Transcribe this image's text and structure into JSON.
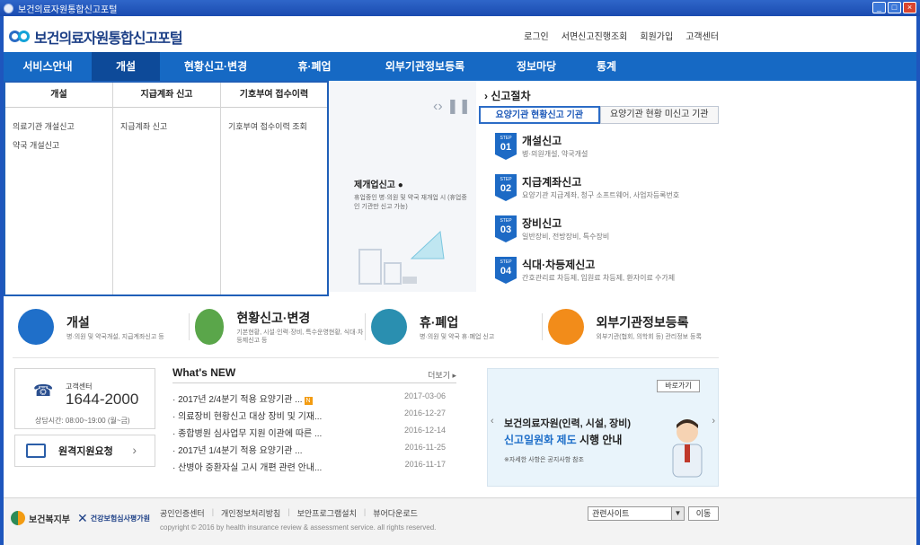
{
  "window": {
    "title": "보건의료자원통합신고포털"
  },
  "header": {
    "logo": "보건의료자원통합신고포털",
    "menu": [
      "로그인",
      "서면신고진행조회",
      "회원가입",
      "고객센터"
    ]
  },
  "nav": {
    "items": [
      "서비스안내",
      "개설",
      "현황신고·변경",
      "휴·폐업",
      "외부기관정보등록",
      "정보마당",
      "통계"
    ],
    "active": "개설"
  },
  "dropdown": {
    "columns": [
      {
        "head": "개설",
        "links": [
          "의료기관 개설신고",
          "약국 개설신고"
        ]
      },
      {
        "head": "지급계좌 신고",
        "links": [
          "지급계좌 신고"
        ]
      },
      {
        "head": "기호부여 접수이력",
        "links": [
          "기호부여 접수이력 조회"
        ]
      }
    ]
  },
  "visual": {
    "title": "제개업신고",
    "desc": "휴업중인 병·의원 및 약국 재개업 시 (휴업중인 기관만 신고 가능)"
  },
  "steps": {
    "title": "신고절차",
    "tabs": [
      "요양기관 현황신고 기관",
      "요양기관 현황 미신고 기관"
    ],
    "items": [
      {
        "badge": "STEP",
        "num": "01",
        "title": "개설신고",
        "desc": "병·의원개설, 약국개설"
      },
      {
        "badge": "STEP",
        "num": "02",
        "title": "지급계좌신고",
        "desc": "요양기관 지급계좌, 청구 소프트웨어, 사업자등록번호"
      },
      {
        "badge": "STEP",
        "num": "03",
        "title": "장비신고",
        "desc": "일반장비, 전방장비, 특수장비"
      },
      {
        "badge": "STEP",
        "num": "04",
        "title": "식대·차등제신고",
        "desc": "간호관리료 차등제, 입원료 차등제, 환자이료 수가제"
      }
    ]
  },
  "quick": [
    {
      "title": "개설",
      "desc": "병·의원 및 약국개설, 지급계좌신고 등",
      "color": "#1f6fc9"
    },
    {
      "title": "현황신고·변경",
      "desc": "기본현황, 시설·인력·장비, 특수운영현황, 식대·차등제신고 등",
      "color": "#5aa64a"
    },
    {
      "title": "휴·폐업",
      "desc": "병·의원 및 약국 휴·폐업 신고",
      "color": "#2a8fb0"
    },
    {
      "title": "외부기관정보등록",
      "desc": "외부기관(협회, 의학회 등) 관리정보 등록",
      "color": "#f28c1a"
    }
  ],
  "customer": {
    "label": "고객센터",
    "number": "1644-2000",
    "hours": "상담시간: 08:00~19:00 (월~금)"
  },
  "remote": {
    "label": "원격지원요청"
  },
  "news": {
    "title": "What's NEW",
    "more": "더보기 ▸",
    "rows": [
      {
        "title": "2017년 2/4분기 적용 요양기관 ...",
        "date": "2017-03-06",
        "new": "N"
      },
      {
        "title": "의료장비 현황신고 대상 장비 및 기재...",
        "date": "2016-12-27"
      },
      {
        "title": "종합병원 심사업무 지원 이관에 따른 ...",
        "date": "2016-12-14"
      },
      {
        "title": "2017년 1/4분기 적용 요양기관 ...",
        "date": "2016-11-25"
      },
      {
        "title": "산병아 중환자실 고시 개편 관련 안내...",
        "date": "2016-11-17"
      }
    ]
  },
  "banner": {
    "go": "바로가기",
    "line1": "보건의료자원(인력, 시설, 장비)",
    "line2_hl": "신고일원화 제도",
    "line2_rest": " 시행 안내",
    "note": "※자세한 사항은 공지사항 참조"
  },
  "footer": {
    "logo1": "보건복지부",
    "logo2": "건강보험심사평가원",
    "links": [
      "공인인증센터",
      "개인정보처리방침",
      "보안프로그램설치",
      "뷰어다운로드"
    ],
    "copyright": "copyright © 2016 by health insurance review & assessment service. all rights reserved.",
    "select": "관련사이트",
    "go": "이동"
  }
}
